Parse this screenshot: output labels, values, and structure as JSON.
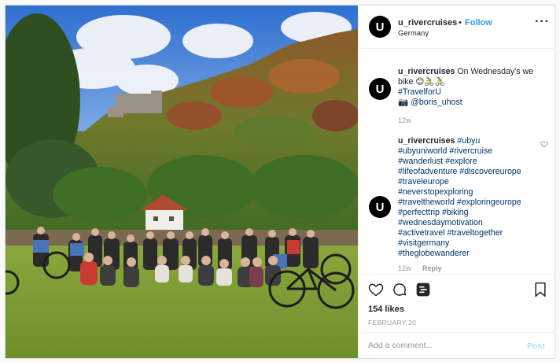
{
  "post": {
    "header": {
      "username": "u_rivercruises",
      "separator": "•",
      "follow_label": "Follow",
      "location": "Germany",
      "avatar_letter": "U",
      "more_icon": "ellipsis-icon"
    },
    "caption": {
      "username": "u_rivercruises",
      "text": "On Wednesday's we bike 😊🚴🚴",
      "hashtag": "#TravelforU",
      "camera_emoji": "📷",
      "mention": "@boris_uhost",
      "time": "12w"
    },
    "comment": {
      "username": "u_rivercruises",
      "hashtags": [
        "#ubyu",
        "#ubyuniworld",
        "#rivercruise",
        "#wanderlust",
        "#explore",
        "#lifeofadventure",
        "#discovereurope",
        "#traveleurope",
        "#neverstopexploring",
        "#traveltheworld",
        "#exploringeurope",
        "#perfecttrip",
        "#biking",
        "#wednesdaymotivation",
        "#activetravel",
        "#traveltogether",
        "#visitgermany",
        "#theglobewanderer"
      ],
      "time": "12w",
      "reply_label": "Reply"
    },
    "actions": {
      "likes": "154 likes",
      "date": "FEBRUARY 20",
      "comment_placeholder": "Add a comment...",
      "post_label": "Post"
    }
  },
  "colors": {
    "link_blue": "#3897f0",
    "hashtag": "#003569",
    "muted": "#999999",
    "post_disabled": "#b2dffc",
    "border": "#efefef"
  }
}
